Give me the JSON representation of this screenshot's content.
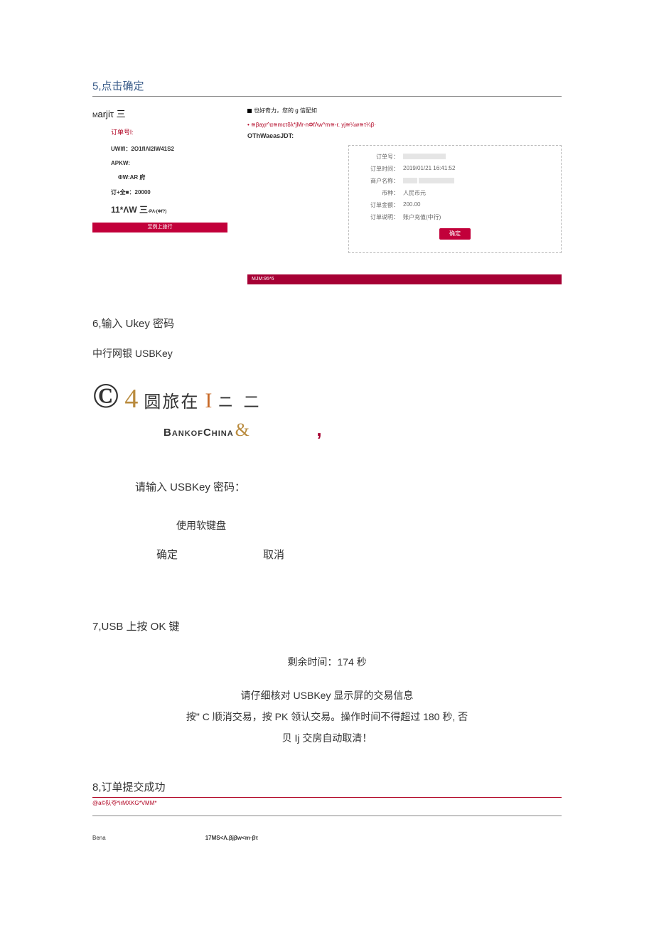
{
  "step5": {
    "title": "5,点击确定",
    "left": {
      "brand_m": "M",
      "brand": "arjiτ 三",
      "order_label": "订单号l:",
      "row_uw": "UWlfl：2O1flΛl2lW41S2",
      "row_apkw": "APKW:",
      "row_phi": "ΦW:AR 府",
      "row_amt": "订+全■：20000",
      "row_big": "11*ΛW 三",
      "row_big_tail": "-PΛ∙(Φf?)",
      "bar": "至例上旅行"
    },
    "right": {
      "line1": "也好奇力，您的 g 信配如",
      "line2": "• ≅βaχr^α≅mcτδλ*jMr-nΦfΛw^m≅-r. yj≅¼w≅τ¼β·",
      "line3": "OThWaeasJDT:",
      "panel": {
        "k1": "订单号：",
        "k2": "订单时间：",
        "v2": "2019/01/21 16:41:52",
        "k3": "商户名称：",
        "k4": "币种：",
        "v4": "人民币元",
        "k5": "订单金额：",
        "v5": "200.00",
        "k6": "订单说明：",
        "v6": "账户充值(中行)",
        "btn": "确定"
      },
      "bottom_bar": "MJM:95*6"
    }
  },
  "step6": {
    "title": "6,输入 Ukey 密码",
    "sub": "中行网银 USBKey",
    "logo": {
      "c": "©",
      "four": "4",
      "txt": "圆旅在",
      "i": "I",
      "tail": "ニ 二"
    },
    "boc": "BankofChina",
    "amp": "&",
    "apostrophe": ",",
    "prompt": "请输入 USBKey 密码：",
    "soft": "使用软键盘",
    "ok": "确定",
    "cancel": "取消"
  },
  "step7": {
    "title": "7,USB 上按 OK 键",
    "timer": "剩余时间：174 秒",
    "line_a": "请仔细核对 USBKey 显示屏的交易信息",
    "line_b": "按\" C 顺消交易，按 PK 领认交易。操作时间不得超过 180 秒, 否",
    "line_c": "贝 Ij 交房自动取清！"
  },
  "step8": {
    "title": "8,订单提交成功",
    "tiny": "@a©队夺*irMXKG*VMM*",
    "col1": "Bena",
    "col2": "17MS<Λ.βjβw<m·βτ"
  }
}
